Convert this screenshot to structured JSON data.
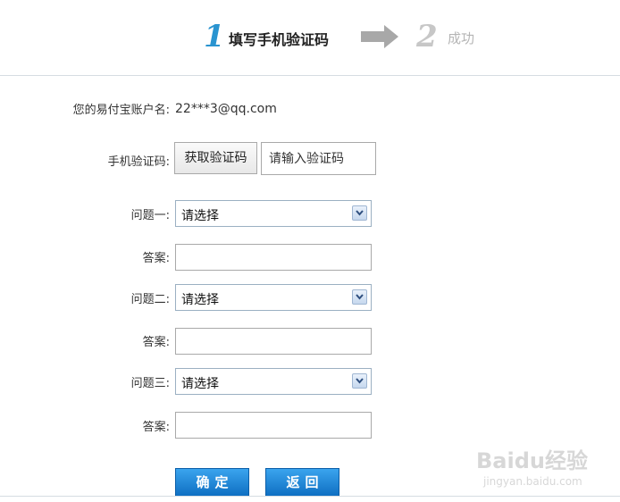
{
  "steps": [
    {
      "number": "1",
      "label": "填写手机验证码",
      "state": "active"
    },
    {
      "number": "2",
      "label": "成功",
      "state": "inactive"
    }
  ],
  "colors": {
    "step_active": "#2a94d0",
    "step_inactive": "#c7c7c7",
    "button_blue": "#1a82d6",
    "arrow": "#a8a8a8"
  },
  "form": {
    "account_label": "您的易付宝账户名:",
    "account_value": "22***3@qq.com",
    "phone_code_label": "手机验证码:",
    "get_code_button": "获取验证码",
    "code_placeholder": "请输入验证码",
    "questions": [
      {
        "question_label": "问题一:",
        "select_value": "请选择",
        "answer_label": "答案:",
        "answer_value": ""
      },
      {
        "question_label": "问题二:",
        "select_value": "请选择",
        "answer_label": "答案:",
        "answer_value": ""
      },
      {
        "question_label": "问题三:",
        "select_value": "请选择",
        "answer_label": "答案:",
        "answer_value": ""
      }
    ],
    "confirm_button": "确定",
    "back_button": "返回"
  },
  "watermark": {
    "logo": "Baidu经验",
    "url": "jingyan.baidu.com"
  }
}
